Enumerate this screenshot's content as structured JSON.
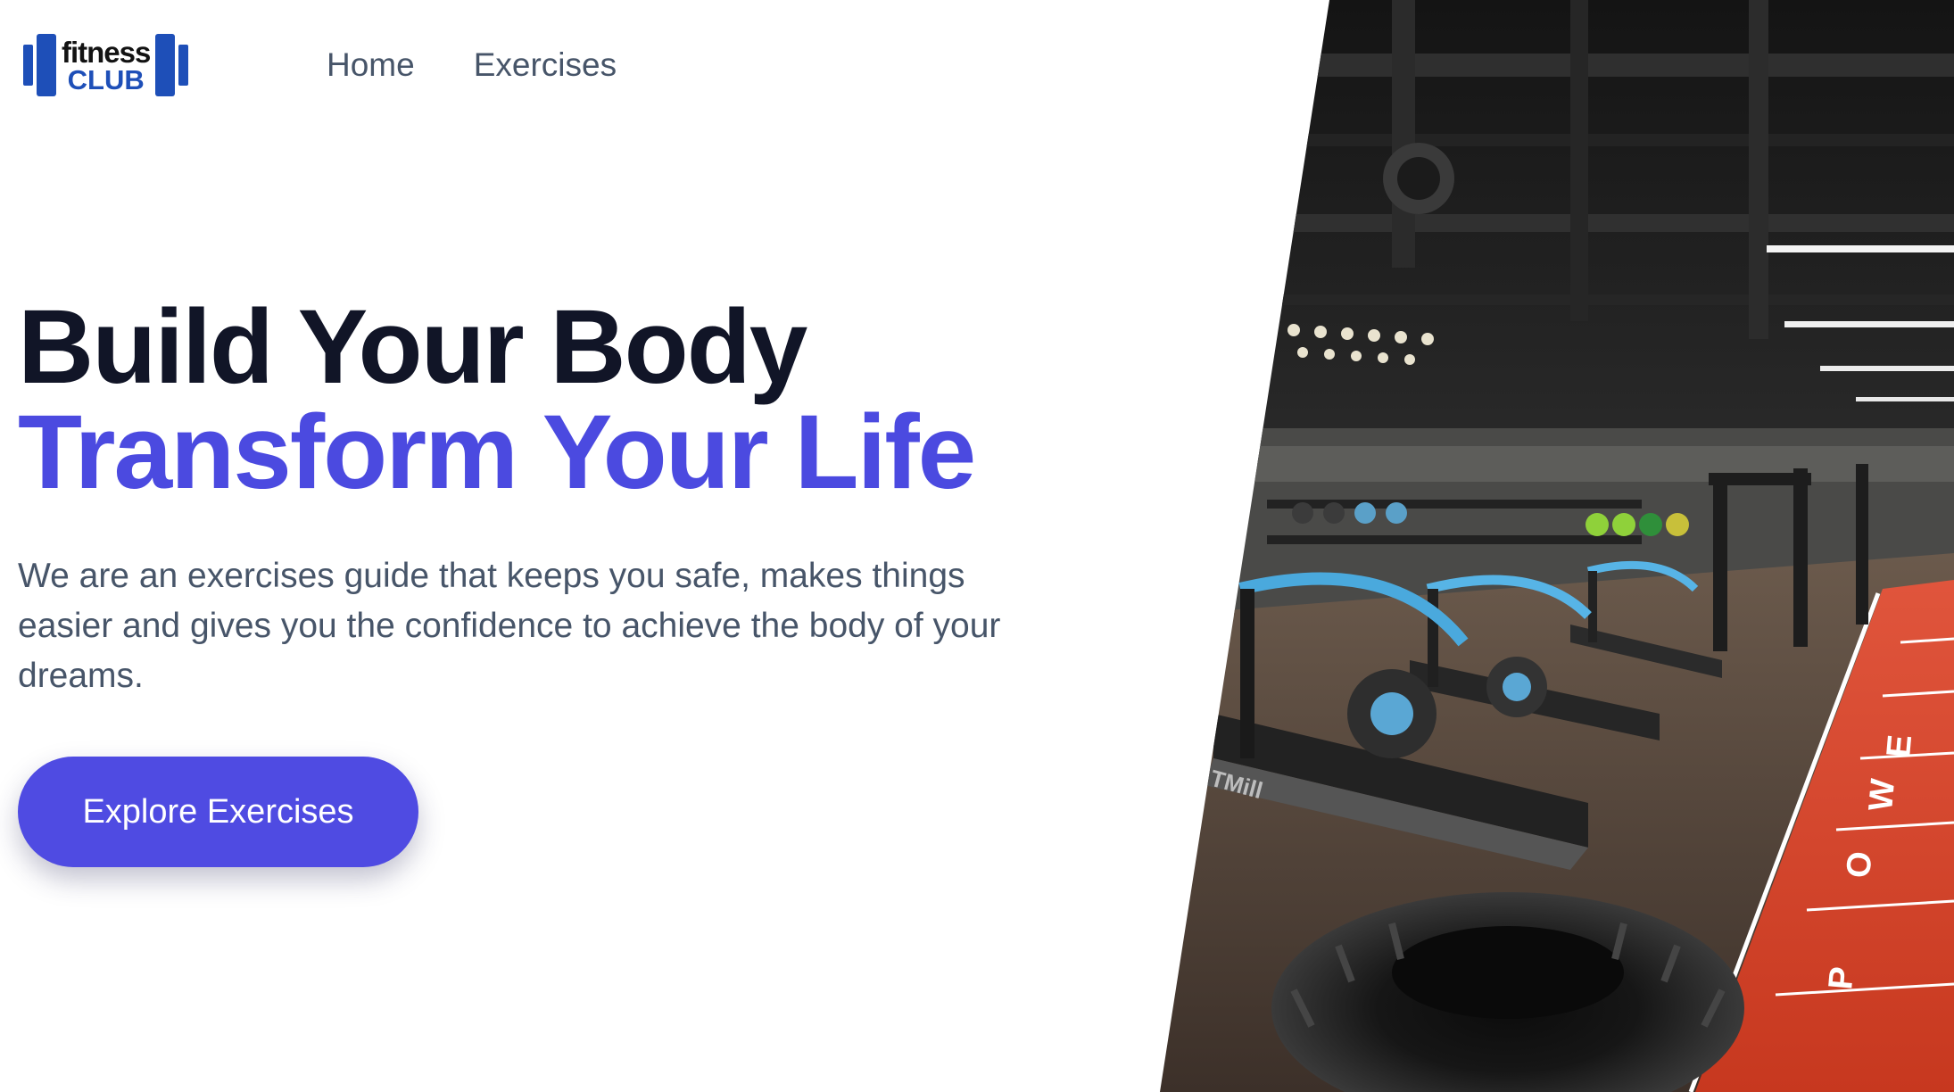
{
  "brand": {
    "line1": "fitness",
    "line2": "CLUB"
  },
  "nav": {
    "items": [
      {
        "label": "Home"
      },
      {
        "label": "Exercises"
      }
    ]
  },
  "hero": {
    "title_line1": "Build Your Body",
    "title_line2": "Transform Your Life",
    "description": "We are an exercises guide that keeps you safe, makes things easier and gives you the confidence to achieve the body of your dreams.",
    "cta_label": "Explore Exercises"
  },
  "gym_image": {
    "machine_brand": "TMill",
    "track_text": "POWER"
  },
  "colors": {
    "accent": "#4f4be2",
    "headline_dark": "#111527",
    "headline_accent": "#4b4ae0",
    "logo_blue": "#1e4fb8",
    "body_text": "#475569",
    "track_red": "#d9432b"
  },
  "icons": {
    "logo": "dumbbell-logo-icon"
  }
}
